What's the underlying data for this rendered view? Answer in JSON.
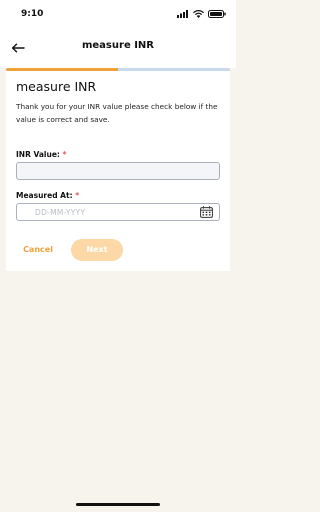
{
  "status_bar": {
    "time": "9:10"
  },
  "header": {
    "title": "measure INR"
  },
  "progress": {
    "fraction": 0.5,
    "fill_color": "#f0a13a",
    "track_color": "#c9d9ee"
  },
  "card": {
    "title": "measure INR",
    "description": "Thank you for your INR value please check below if the value is correct and save."
  },
  "fields": {
    "inr": {
      "label": "INR Value:",
      "required_mark": "*",
      "value": ""
    },
    "measured_at": {
      "label": "Measured At:",
      "required_mark": "*",
      "placeholder": "DD-MM-YYYY"
    }
  },
  "actions": {
    "cancel_label": "Cancel",
    "next_label": "Next"
  },
  "colors": {
    "accent": "#f0a13a",
    "next_disabled_bg": "#fbd8a6",
    "background": "#f7f4ee"
  }
}
